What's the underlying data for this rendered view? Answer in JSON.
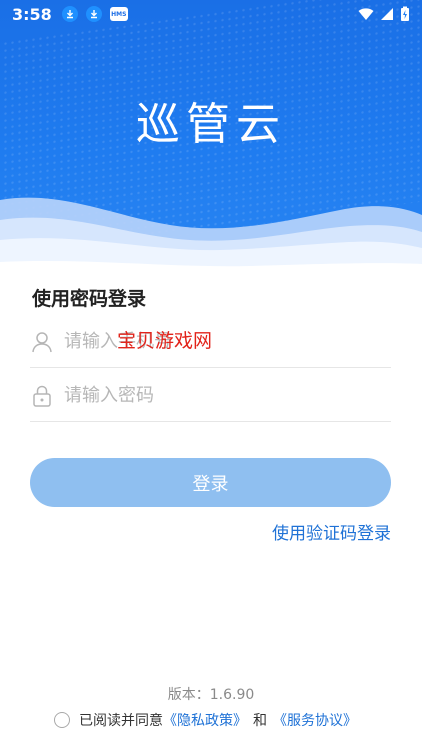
{
  "status_bar": {
    "time": "3:58",
    "notification_icons": [
      "download-icon",
      "download-icon",
      "hms-icon"
    ],
    "hms_label": "HMS",
    "right_icons": [
      "wifi-icon",
      "signal-icon",
      "battery-charging-icon"
    ]
  },
  "header": {
    "app_name": "巡管云"
  },
  "login": {
    "heading": "使用密码登录",
    "phone_placeholder": "请输入手机号",
    "password_placeholder": "请输入密码",
    "submit_label": "登录",
    "alternate_login_label": "使用验证码登录"
  },
  "overlay": {
    "watermark_text": "宝贝游戏网"
  },
  "footer": {
    "version": "版本：1.6.90",
    "agree_prefix": "已阅读并同意",
    "privacy_link": "《隐私政策》",
    "agree_and": "和",
    "service_link": "《服务协议》"
  },
  "colors": {
    "brand_blue": "#1f7cf0",
    "button_disabled": "#8fbff0",
    "link_blue": "#1f72d6",
    "watermark_red": "#e2231a"
  }
}
